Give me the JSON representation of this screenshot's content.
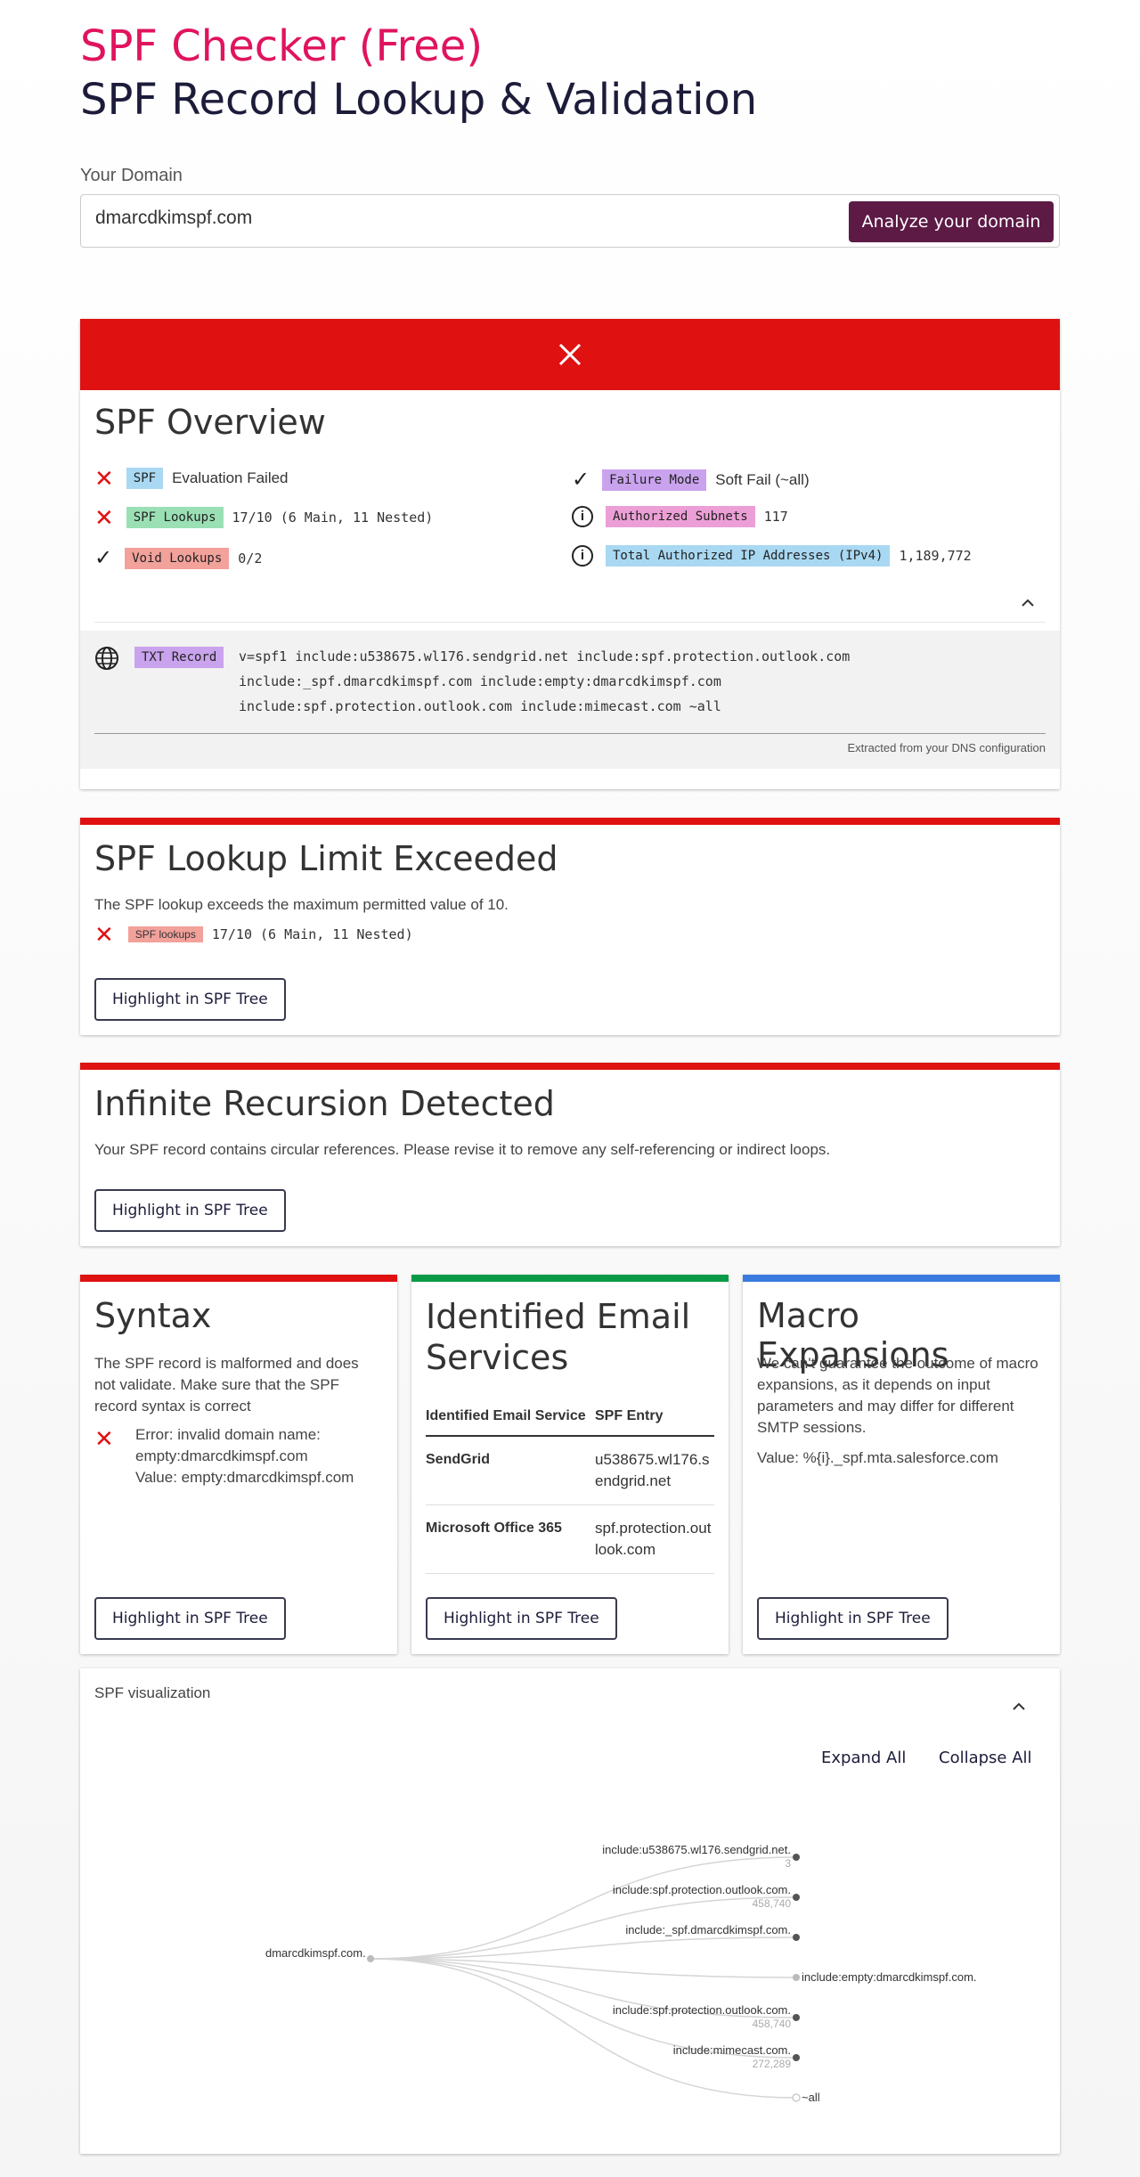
{
  "header": {
    "brand": "SPF Checker (Free)",
    "title": "SPF Record Lookup & Validation"
  },
  "domain_form": {
    "label": "Your Domain",
    "value": "dmarcdkimspf.com",
    "button": "Analyze your domain"
  },
  "overview": {
    "status_icon": "close-icon",
    "title": "SPF Overview",
    "left": [
      {
        "icon": "x",
        "tag": "SPF",
        "value": "Evaluation Failed"
      },
      {
        "icon": "x",
        "tag": "SPF Lookups",
        "value": "17/10 (6 Main, 11 Nested)"
      },
      {
        "icon": "check",
        "tag": "Void Lookups",
        "value": "0/2"
      }
    ],
    "right": [
      {
        "icon": "check",
        "tag": "Failure Mode",
        "value": "Soft Fail (~all)"
      },
      {
        "icon": "info",
        "tag": "Authorized Subnets",
        "value": "117"
      },
      {
        "icon": "info",
        "tag": "Total Authorized IP Addresses (IPv4)",
        "value": "1,189,772"
      }
    ],
    "txt_tag": "TXT Record",
    "txt_lines": [
      "v=spf1 include:u538675.wl176.sendgrid.net include:spf.protection.outlook.com",
      "include:_spf.dmarcdkimspf.com include:empty:dmarcdkimspf.com",
      "include:spf.protection.outlook.com include:mimecast.com ~all"
    ],
    "txt_note": "Extracted from your DNS configuration"
  },
  "lookup_limit": {
    "title": "SPF Lookup Limit Exceeded",
    "desc": "The SPF lookup exceeds the maximum permitted value of 10.",
    "tag": "SPF lookups",
    "value": "17/10 (6 Main, 11 Nested)",
    "button": "Highlight in SPF Tree"
  },
  "recursion": {
    "title": "Infinite Recursion Detected",
    "desc": "Your SPF record contains circular references. Please revise it to remove any self-referencing or indirect loops.",
    "button": "Highlight in SPF Tree"
  },
  "syntax": {
    "title": "Syntax",
    "desc": "The SPF record is malformed and does not validate. Make sure that the SPF record syntax is correct",
    "error_lines": [
      "Error: invalid domain name:",
      "empty:dmarcdkimspf.com",
      "Value: empty:dmarcdkimspf.com"
    ],
    "button": "Highlight in SPF Tree"
  },
  "services": {
    "title": "Identified Email Services",
    "col1": "Identified Email Service",
    "col2": "SPF Entry",
    "rows": [
      {
        "service": "SendGrid",
        "entry": "u538675.wl176.sendgrid.net"
      },
      {
        "service": "Microsoft Office 365",
        "entry": "spf.protection.outlook.com"
      }
    ],
    "button": "Highlight in SPF Tree"
  },
  "macro": {
    "title": "Macro Expansions",
    "desc": "We can't guarantee the outcome of macro expansions, as it depends on input parameters and may differ for different SMTP sessions.",
    "value": "Value: %{i}._spf.mta.salesforce.com",
    "button": "Highlight in SPF Tree"
  },
  "viz": {
    "title": "SPF visualization",
    "expand": "Expand All",
    "collapse": "Collapse All",
    "root": "dmarcdkimspf.com.",
    "nodes": [
      {
        "label": "include:u538675.wl176.sendgrid.net.",
        "sub": "3"
      },
      {
        "label": "include:spf.protection.outlook.com.",
        "sub": "458,740"
      },
      {
        "label": "include:_spf.dmarcdkimspf.com.",
        "sub": ""
      },
      {
        "label": "include:empty:dmarcdkimspf.com.",
        "sub": ""
      },
      {
        "label": "include:spf.protection.outlook.com.",
        "sub": "458,740"
      },
      {
        "label": "include:mimecast.com.",
        "sub": "272,289"
      },
      {
        "label": "~all",
        "sub": ""
      }
    ]
  }
}
